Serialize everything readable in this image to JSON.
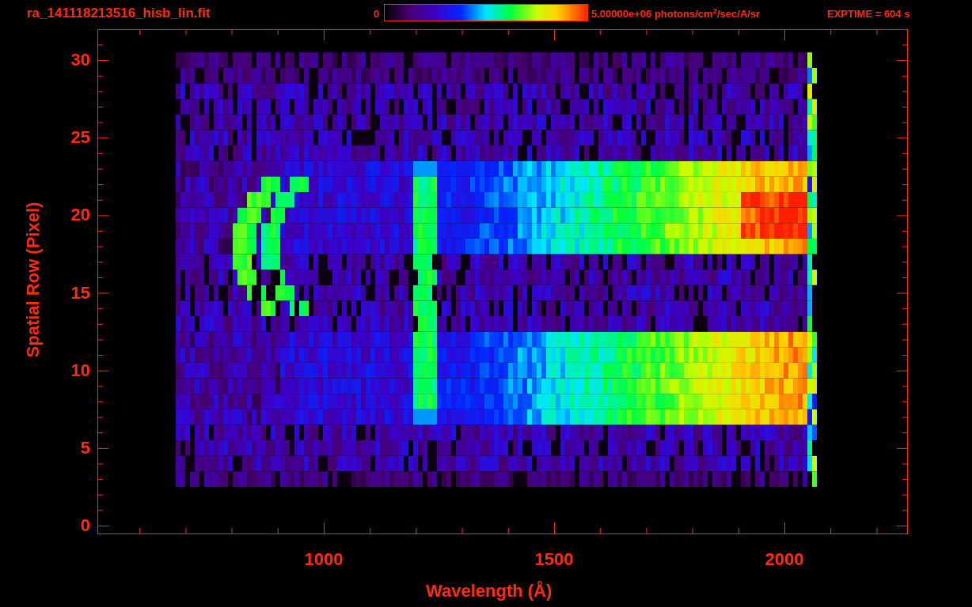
{
  "title": "ra_141118213516_hisb_lin.fit",
  "colorbar": {
    "min_label": "0",
    "max_label": "5.00000e+06 photons/cm$^{2}$/sec/A/sr"
  },
  "exposure": "EXPTIME = 604 s",
  "x_axis": {
    "title": "Wavelength (Å)",
    "tick_labels": [
      "1000",
      "1500",
      "2000"
    ]
  },
  "y_axis": {
    "title": "Spatial Row (Pixel)",
    "tick_labels": [
      "30",
      "25",
      "20",
      "15",
      "10",
      "5",
      "0"
    ]
  }
}
